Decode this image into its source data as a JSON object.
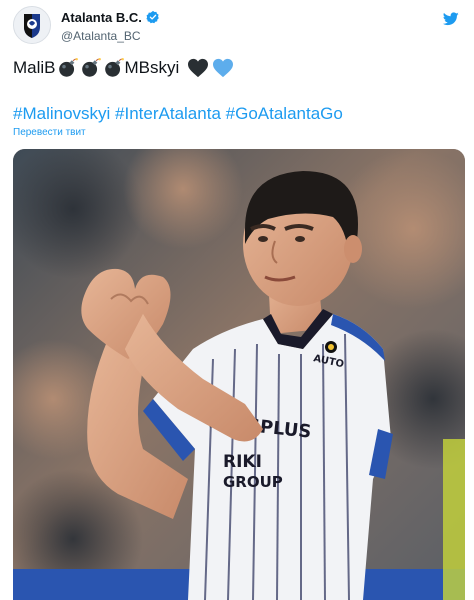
{
  "account": {
    "display_name": "Atalanta B.C.",
    "handle": "@Atalanta_BC",
    "verified_icon": "verified-badge-icon",
    "avatar_icon": "atalanta-crest-icon"
  },
  "tweet": {
    "text_parts": {
      "part1": "MaliB",
      "part2": "MBskyi"
    },
    "emojis": [
      "bomb",
      "bomb",
      "bomb",
      "black-heart",
      "blue-heart"
    ],
    "hashtags": [
      "#Malinovskyi",
      "#InterAtalanta",
      "#GoAtalantaGo"
    ],
    "translate_label": "Перевести твит"
  },
  "media": {
    "kit_sponsor": "PLUSPLUS",
    "shirt_text_1": "RIKI",
    "shirt_text_2": "GROUP",
    "shirt_brand": "AUTO"
  },
  "colors": {
    "accent": "#1d9bf0",
    "text": "#0f1419",
    "secondary_text": "#536471"
  }
}
